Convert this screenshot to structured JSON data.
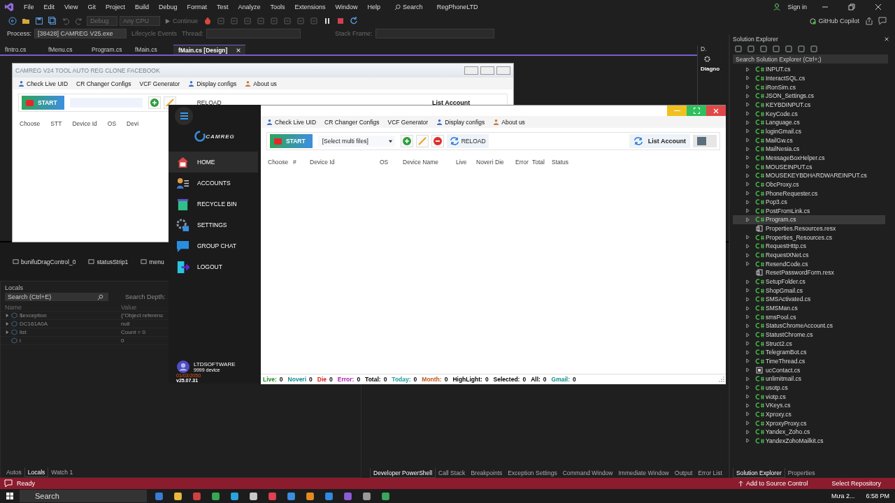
{
  "ide": {
    "menus": [
      "File",
      "Edit",
      "View",
      "Git",
      "Project",
      "Build",
      "Debug",
      "Format",
      "Test",
      "Analyze",
      "Tools",
      "Extensions",
      "Window",
      "Help"
    ],
    "search": "Search",
    "solution_name": "RegPhoneLTD",
    "sign_in": "Sign in",
    "copilot": "GitHub Copilot"
  },
  "toolbar": {
    "configuration": "Debug",
    "platform": "Any CPU",
    "continue": "Continue",
    "process_label": "Process:",
    "process": "[38428] CAMREG V25.exe",
    "lifecycle": "Lifecycle Events",
    "thread_label": "Thread:",
    "stack_frame_label": "Stack Frame:"
  },
  "doc_tabs": [
    {
      "label": "fIntro.cs",
      "selected": false
    },
    {
      "label": "fMenu.cs",
      "selected": false
    },
    {
      "label": "Program.cs",
      "selected": false
    },
    {
      "label": "fMain.cs",
      "selected": false
    },
    {
      "label": "fMain.cs [Design]",
      "selected": true
    }
  ],
  "side_pane": {
    "tab": "D.",
    "text": "Diagno"
  },
  "designer_form": {
    "title": "CAMREG V24 TOOL AUTO REG CLONE FACEBOOK",
    "menu": [
      {
        "label": "Check Live UID",
        "kind": "users"
      },
      {
        "label": "CR Changer Configs",
        "kind": "plain"
      },
      {
        "label": "VCF Generator",
        "kind": "plain"
      },
      {
        "label": "Display configs",
        "kind": "list"
      },
      {
        "label": "About us",
        "kind": "person"
      }
    ],
    "start": "START",
    "reload": "RELOAD",
    "list_account": "List Account",
    "columns": [
      "Choose",
      "STT",
      "Device Id",
      "OS",
      "Devi"
    ]
  },
  "component_tray": [
    "bunifuDragControl_0",
    "statusStrip1",
    "menu"
  ],
  "locals": {
    "title": "Locals",
    "search": "Search (Ctrl+E)",
    "depth": "Search Depth:",
    "columns": [
      "Name",
      "Value"
    ],
    "rows": [
      {
        "name": "$exception",
        "value": "{\"Object referenc",
        "expandable": true
      },
      {
        "name": "DC161A0A",
        "value": "null",
        "expandable": true
      },
      {
        "name": "list",
        "value": "Count = 0",
        "expandable": true
      },
      {
        "name": "i",
        "value": "0",
        "expandable": false
      }
    ],
    "tabs": [
      {
        "label": "Autos",
        "selected": false
      },
      {
        "label": "Locals",
        "selected": true
      },
      {
        "label": "Watch 1",
        "selected": false
      }
    ]
  },
  "output_tabs": [
    {
      "label": "Developer PowerShell",
      "selected": true
    },
    {
      "label": "Call Stack",
      "selected": false
    },
    {
      "label": "Breakpoints",
      "selected": false
    },
    {
      "label": "Exception Settings",
      "selected": false
    },
    {
      "label": "Command Window",
      "selected": false
    },
    {
      "label": "Immediate Window",
      "selected": false
    },
    {
      "label": "Output",
      "selected": false
    },
    {
      "label": "Error List",
      "selected": false
    }
  ],
  "solution_explorer": {
    "title": "Solution Explorer",
    "search": "Search Solution Explorer (Ctrl+;)",
    "items": [
      {
        "name": "INPUT.cs",
        "kind": "cs",
        "selected": false
      },
      {
        "name": "InteractSQL.cs",
        "kind": "cs",
        "selected": false
      },
      {
        "name": "iRonSim.cs",
        "kind": "cs",
        "selected": false
      },
      {
        "name": "JSON_Settings.cs",
        "kind": "cs",
        "selected": false
      },
      {
        "name": "KEYBDINPUT.cs",
        "kind": "cs",
        "selected": false
      },
      {
        "name": "KeyCode.cs",
        "kind": "cs",
        "selected": false
      },
      {
        "name": "Language.cs",
        "kind": "cs",
        "selected": false
      },
      {
        "name": "loginGmail.cs",
        "kind": "cs",
        "selected": false
      },
      {
        "name": "MailGw.cs",
        "kind": "cs",
        "selected": false
      },
      {
        "name": "MailNesia.cs",
        "kind": "cs",
        "selected": false
      },
      {
        "name": "MessageBoxHelper.cs",
        "kind": "cs",
        "selected": false
      },
      {
        "name": "MOUSEINPUT.cs",
        "kind": "cs",
        "selected": false
      },
      {
        "name": "MOUSEKEYBDHARDWAREINPUT.cs",
        "kind": "cs",
        "selected": false
      },
      {
        "name": "ObcProxy.cs",
        "kind": "cs",
        "selected": false
      },
      {
        "name": "PhoneRequester.cs",
        "kind": "cs",
        "selected": false
      },
      {
        "name": "Pop3.cs",
        "kind": "cs",
        "selected": false
      },
      {
        "name": "PostFromLink.cs",
        "kind": "cs",
        "selected": false
      },
      {
        "name": "Program.cs",
        "kind": "cs",
        "selected": true
      },
      {
        "name": "Properties.Resources.resx",
        "kind": "resx",
        "selected": false
      },
      {
        "name": "Properties_Resources.cs",
        "kind": "cs",
        "selected": false
      },
      {
        "name": "RequestHttp.cs",
        "kind": "cs",
        "selected": false
      },
      {
        "name": "RequestXNet.cs",
        "kind": "cs",
        "selected": false
      },
      {
        "name": "ResendCode.cs",
        "kind": "cs",
        "selected": false
      },
      {
        "name": "ResetPasswordForm.resx",
        "kind": "resx",
        "selected": false
      },
      {
        "name": "SetupFolder.cs",
        "kind": "cs",
        "selected": false
      },
      {
        "name": "ShopGmail.cs",
        "kind": "cs",
        "selected": false
      },
      {
        "name": "SMSActivated.cs",
        "kind": "cs",
        "selected": false
      },
      {
        "name": "SMSMan.cs",
        "kind": "cs",
        "selected": false
      },
      {
        "name": "smsPool.cs",
        "kind": "cs",
        "selected": false
      },
      {
        "name": "StatusChromeAccount.cs",
        "kind": "cs",
        "selected": false
      },
      {
        "name": "StatustChrome.cs",
        "kind": "cs",
        "selected": false
      },
      {
        "name": "Struct2.cs",
        "kind": "cs",
        "selected": false
      },
      {
        "name": "TelegramBot.cs",
        "kind": "cs",
        "selected": false
      },
      {
        "name": "TimeThread.cs",
        "kind": "cs",
        "selected": false
      },
      {
        "name": "ucContact.cs",
        "kind": "control",
        "selected": false
      },
      {
        "name": "unlimitmail.cs",
        "kind": "cs",
        "selected": false
      },
      {
        "name": "usotp.cs",
        "kind": "cs",
        "selected": false
      },
      {
        "name": "viotp.cs",
        "kind": "cs",
        "selected": false
      },
      {
        "name": "VKeys.cs",
        "kind": "cs",
        "selected": false
      },
      {
        "name": "Xproxy.cs",
        "kind": "cs",
        "selected": false
      },
      {
        "name": "XproxyProxy.cs",
        "kind": "cs",
        "selected": false
      },
      {
        "name": "Yandex_Zoho.cs",
        "kind": "cs",
        "selected": false
      },
      {
        "name": "YandexZohoMailkit.cs",
        "kind": "cs",
        "selected": false
      }
    ],
    "tabs": [
      {
        "label": "Solution Explorer",
        "selected": true
      },
      {
        "label": "Properties",
        "selected": false
      }
    ]
  },
  "app": {
    "sidebar": {
      "logo": "CAMREG",
      "items": [
        {
          "label": "HOME",
          "kind": "home",
          "selected": true
        },
        {
          "label": "ACCOUNTS",
          "kind": "accounts",
          "selected": false
        },
        {
          "label": "RECYCLE BIN",
          "kind": "bin",
          "selected": false
        },
        {
          "label": "SETTINGS",
          "kind": "settings",
          "selected": false
        },
        {
          "label": "GROUP CHAT",
          "kind": "chat",
          "selected": false
        },
        {
          "label": "LOGOUT",
          "kind": "logout",
          "selected": false
        }
      ],
      "user": "LTDSOFTWARE",
      "devices": "9999 device",
      "expiry": "01/03/2050",
      "version": "v25.07.31"
    },
    "menu": [
      {
        "label": "Check Live UID",
        "kind": "users"
      },
      {
        "label": "CR Changer Configs",
        "kind": "plain"
      },
      {
        "label": "VCF Generator",
        "kind": "plain"
      },
      {
        "label": "Display configs",
        "kind": "list"
      },
      {
        "label": "About us",
        "kind": "person"
      }
    ],
    "start": "START",
    "file_select": "[Select multi files]",
    "reload": "RELOAD",
    "list_account": "List Account",
    "toggle": {
      "on": false
    },
    "columns": [
      "Choose",
      "#",
      "Device Id",
      "OS",
      "Device Name",
      "Live",
      "Noveri",
      "Die",
      "Error",
      "Total",
      "Status"
    ],
    "stats": [
      {
        "label": "Live:",
        "value": "0",
        "color": "#1f8a1f"
      },
      {
        "label": "Noveri",
        "value": "0",
        "color": "#0e8c8c"
      },
      {
        "label": "Die",
        "value": "0",
        "color": "#e01818"
      },
      {
        "label": "Error:",
        "value": "0",
        "color": "#b01cb0"
      },
      {
        "label": "Total:",
        "value": "0",
        "color": "#000000"
      },
      {
        "label": "Today:",
        "value": "0",
        "color": "#1b9aa0"
      },
      {
        "label": "Month:",
        "value": "0",
        "color": "#c0541a"
      },
      {
        "label": "HighLight:",
        "value": "0",
        "color": "#000000"
      },
      {
        "label": "Selected:",
        "value": "0",
        "color": "#000000"
      },
      {
        "label": "All:",
        "value": "0",
        "color": "#000000"
      },
      {
        "label": "Gmail:",
        "value": "0",
        "color": "#0e8c8c"
      }
    ]
  },
  "status_bar": {
    "text": "Ready",
    "source_control": "Add to Source Control",
    "repository": "Select Repository"
  },
  "taskbar": {
    "search": "Search",
    "weather": "Mưa 2...",
    "time": "6:58 PM"
  }
}
